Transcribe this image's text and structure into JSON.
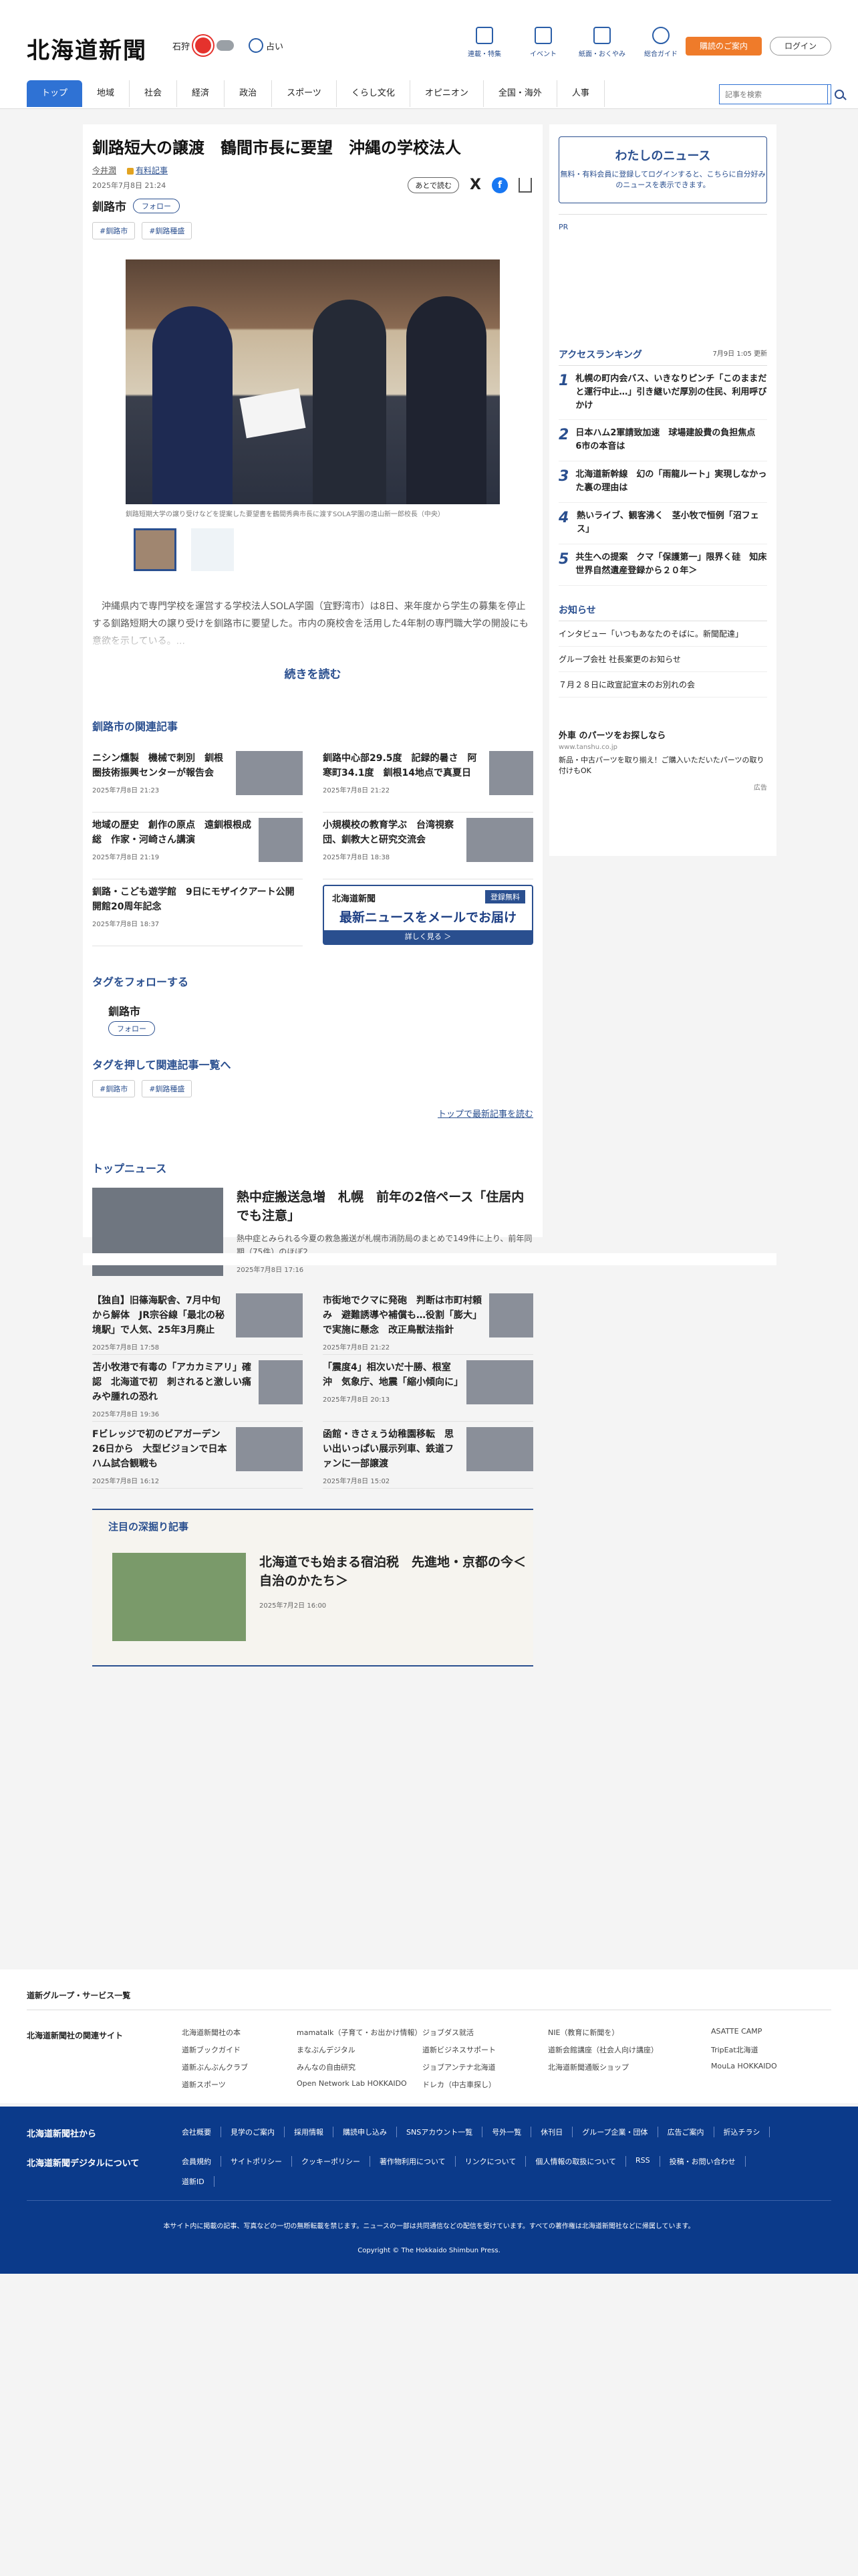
{
  "header": {
    "logo": "北海道新聞",
    "weather_location": "石狩",
    "fortune": "占い",
    "nav": [
      "連載・特集",
      "イベント",
      "紙面・おくやみ",
      "総合ガイド"
    ],
    "subscribe": "購読のご案内",
    "login": "ログイン",
    "gnav": [
      "トップ",
      "地域",
      "社会",
      "経済",
      "政治",
      "スポーツ",
      "くらし文化",
      "オピニオン",
      "全国・海外",
      "人事"
    ],
    "search_placeholder": "記事を検索"
  },
  "article": {
    "title": "釧路短大の譲渡　鶴間市長に要望　沖縄の学校法人",
    "author": "今井潤",
    "paid": "有料記事",
    "date": "2025年7月8日 21:24",
    "follow_name": "釧路市",
    "follow_label": "フォロー",
    "save_label": "あとで読む",
    "tags": [
      "#釧路市",
      "#釧路種盛"
    ],
    "caption": "釧路短期大学の譲り受けなどを提案した要望書を鶴間秀典市長に渡すSOLA学園の遠山新一郎校長（中央）",
    "lead": "沖縄県内で専門学校を運営する学校法人SOLA学園（宜野湾市）は8日、来年度から学生の募集を停止する釧路短期大の譲り受けを釧路市に要望した。市内の廃校舎を活用した4年制の専門職大学の開設にも意欲を示している。...",
    "more": "続きを読む"
  },
  "related": {
    "title": "釧路市の関連記事",
    "items": [
      {
        "h": "ニシン燻製　機械で刺別　釧根圏技術振興センターが報告会",
        "d": "2025年7月8日 21:23"
      },
      {
        "h": "釧路中心部29.5度　記録的暑さ　阿寒町34.1度　釧根14地点で真夏日",
        "d": "2025年7月8日 21:22"
      },
      {
        "h": "地域の歴史　創作の原点　遠釧根根成総　作家・河崎さん講演",
        "d": "2025年7月8日 21:19"
      },
      {
        "h": "小規模校の教育学ぶ　台湾視察団、釧教大と研究交流会",
        "d": "2025年7月8日 18:38"
      },
      {
        "h": "釧路・こども遊学館　9日にモザイクアート公開　開館20周年記念",
        "d": "2025年7月8日 18:37"
      }
    ],
    "banner_logo": "北海道新聞",
    "banner_free": "登録無料",
    "banner_big": "最新ニュースをメールでお届け",
    "banner_sub": "詳しく見る ＞"
  },
  "tagfollow": {
    "title": "タグをフォローする",
    "name": "釧路市",
    "btn": "フォロー",
    "title2": "タグを押して関連記事一覧へ",
    "tags": [
      "#釧路市",
      "#釧路種盛"
    ],
    "toplink": "トップで最新記事を読む"
  },
  "topnews": {
    "title": "トップニュース",
    "main": {
      "h": "熱中症搬送急増　札幌　前年の2倍ペース「住居内でも注意」",
      "s": "熱中症とみられる今夏の救急搬送が札幌市消防局のまとめで149件に上り、前年同期（75件）のほぼ2...",
      "d": "2025年7月8日 17:16"
    },
    "items": [
      {
        "h": "【独自】旧篠海駅舎、7月中旬から解体　JR宗谷線「最北の秘境駅」で人気、25年3月廃止",
        "d": "2025年7月8日 17:58"
      },
      {
        "h": "市街地でクマに発砲　判断は市町村頼み　避難誘導や補償も…役割「膨大」で実施に懸念　改正鳥獣法指針",
        "d": "2025年7月8日 21:22"
      },
      {
        "h": "苫小牧港で有毒の「アカカミアリ」確認　北海道で初　刺されると激しい痛みや腫れの恐れ",
        "d": "2025年7月8日 19:36"
      },
      {
        "h": "「震度4」相次いだ十勝、根室沖　気象庁、地震「縮小傾向に」",
        "d": "2025年7月8日 20:13"
      },
      {
        "h": "Fビレッジで初のビアガーデン　26日から　大型ビジョンで日本ハム試合観戦も",
        "d": "2025年7月8日 16:12"
      },
      {
        "h": "函館・きさぇう幼稚園移転　思い出いっぱい展示列車、鉄道ファンに一部譲渡",
        "d": "2025年7月8日 15:02"
      }
    ]
  },
  "deep": {
    "label": "注目の深掘り記事",
    "h": "北海道でも始まる宿泊税　先進地・京都の今＜自治のかたち＞",
    "d": "2025年7月2日 16:00"
  },
  "side": {
    "mynews_title": "わたしのニュース",
    "mynews_text": "無料・有料会員に登録してログインすると、こちらに自分好みのニュースを表示できます。",
    "pr": "PR",
    "rank_title": "アクセスランキング",
    "rank_updated": "7月9日 1:05 更新",
    "ranking": [
      "札幌の町内会バス、いきなりピンチ「このままだと運行中止…」引き継いだ厚別の住民、利用呼びかけ",
      "日本ハム2軍請致加速　球場建設費の負担焦点　6市の本音は",
      "北海道新幹線　幻の「雨龍ルート」実現しなかった裏の理由は",
      "熱いライブ、観客沸く　茎小牧で恒例「沼フェス」",
      "共生への提案　クマ「保護第一」限界く硅　知床　世界自然遺産登録から２０年＞"
    ],
    "notice_title": "お知らせ",
    "notices": [
      "インタビュー「いつもあなたのそばに。新聞配達」",
      "グループ会社 社長案更のお知らせ",
      "７月２８日に政宣記宣末のお別れの会"
    ],
    "ad_title": "外車 のパーツをお探しなら",
    "ad_url": "www.tanshu.co.jp",
    "ad_text": "新品・中古パーツを取り揃え！ご購入いただいたパーツの取り付けもOK",
    "ad_pr": "広告"
  },
  "footer": {
    "group_link": "道新グループ・サービス一覧",
    "related_label": "北海道新聞社の関連サイト",
    "sites": [
      "北海道新聞社の本",
      "mamatalk（子育て・お出かけ情報）",
      "ジョブダス就活",
      "NIE（教育に新聞を）",
      "ASATTE CAMP",
      "道新ブックガイド",
      "まなぶんデジタル",
      "道新ビジネスサポート",
      "道新会館講座（社会人向け講座）",
      "TripEat北海道",
      "道新ぶんぶんクラブ",
      "みんなの自由研究",
      "ジョブアンテナ北海道",
      "北海道新聞通販ショップ",
      "MouLa HOKKAIDO",
      "道新スポーツ",
      "Open Network Lab HOKKAIDO",
      "ドレカ（中古車探し）"
    ],
    "from_label": "北海道新聞社から",
    "about_label": "北海道新聞デジタルについて",
    "row1": [
      "会社概要",
      "見学のご案内",
      "採用情報",
      "購読申し込み",
      "SNSアカウント一覧",
      "号外一覧",
      "休刊日",
      "グループ企業・団体",
      "広告ご案内",
      "折込チラシ"
    ],
    "row2": [
      "会員規約",
      "サイトポリシー",
      "クッキーポリシー",
      "著作物利用について",
      "リンクについて",
      "個人情報の取扱について",
      "RSS",
      "投稿・お問い合わせ",
      "道新ID"
    ],
    "note": "本サイト内に掲載の記事、写真などの一切の無断転載を禁じます。ニュースの一部は共同通信などの配信を受けています。すべての著作権は北海道新聞社などに帰属しています。",
    "copyright": "Copyright © The Hokkaido Shimbun Press."
  }
}
